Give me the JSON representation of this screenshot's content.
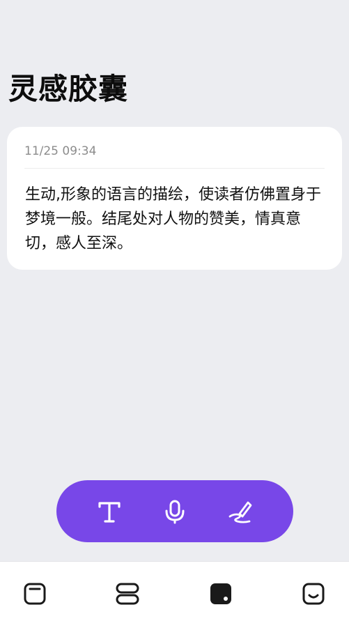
{
  "header": {
    "title": "灵感胶囊"
  },
  "note": {
    "timestamp": "11/25 09:34",
    "content": "生动,形象的语言的描绘，使读者仿佛置身于梦境一般。结尾处对人物的赞美，情真意切，感人至深。"
  },
  "input_bar": {
    "color": "#7847e8",
    "buttons": [
      {
        "icon": "text-icon"
      },
      {
        "icon": "microphone-icon"
      },
      {
        "icon": "handwriting-icon"
      }
    ]
  },
  "bottom_nav": {
    "active_index": 2,
    "items": [
      {
        "icon": "single-card-icon"
      },
      {
        "icon": "stacked-cards-icon"
      },
      {
        "icon": "capsule-icon"
      },
      {
        "icon": "smile-face-icon"
      }
    ]
  }
}
